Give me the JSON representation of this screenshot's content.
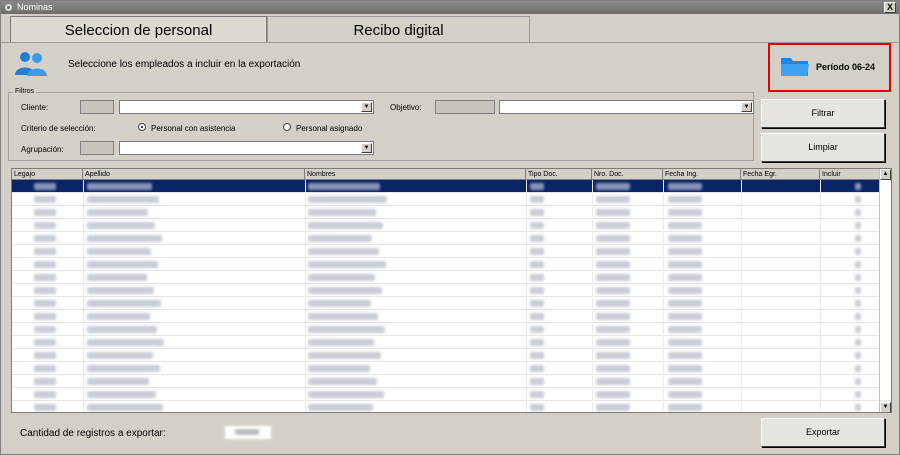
{
  "window": {
    "title": "Nominas",
    "close_label": "X"
  },
  "tabs": [
    {
      "label": "Seleccion de personal",
      "active": true
    },
    {
      "label": "Recibo digital",
      "active": false
    }
  ],
  "header": {
    "instruction": "Seleccione los empleados a incluir en la exportación",
    "users_icon": "users-icon",
    "periodo": {
      "icon": "folder-icon",
      "label": "Período 06-24"
    }
  },
  "filters": {
    "title": "Filtros",
    "cliente_label": "Cliente:",
    "objetivo_label": "Objetivo:",
    "criterio_label": "Criterio de selección:",
    "radio_asistencia": "Personal con asistencia",
    "radio_asignado": "Personal asignado",
    "agrupacion_label": "Agrupación:",
    "selected_criterio": "Personal con asistencia"
  },
  "buttons": {
    "filtrar": "Filtrar",
    "limpiar": "Limpiar",
    "exportar": "Exportar"
  },
  "table": {
    "columns": [
      "Legajo",
      "Apellido",
      "Nombres",
      "Tipo Doc.",
      "Nro. Doc.",
      "Fecha Ing.",
      "Fecha Egr.",
      "Incluir"
    ],
    "row_count_visible": 18
  },
  "footer": {
    "count_label": "Cantidad de registros a exportar:"
  },
  "colors": {
    "highlight": "#e00000",
    "selection": "#0a2466"
  }
}
